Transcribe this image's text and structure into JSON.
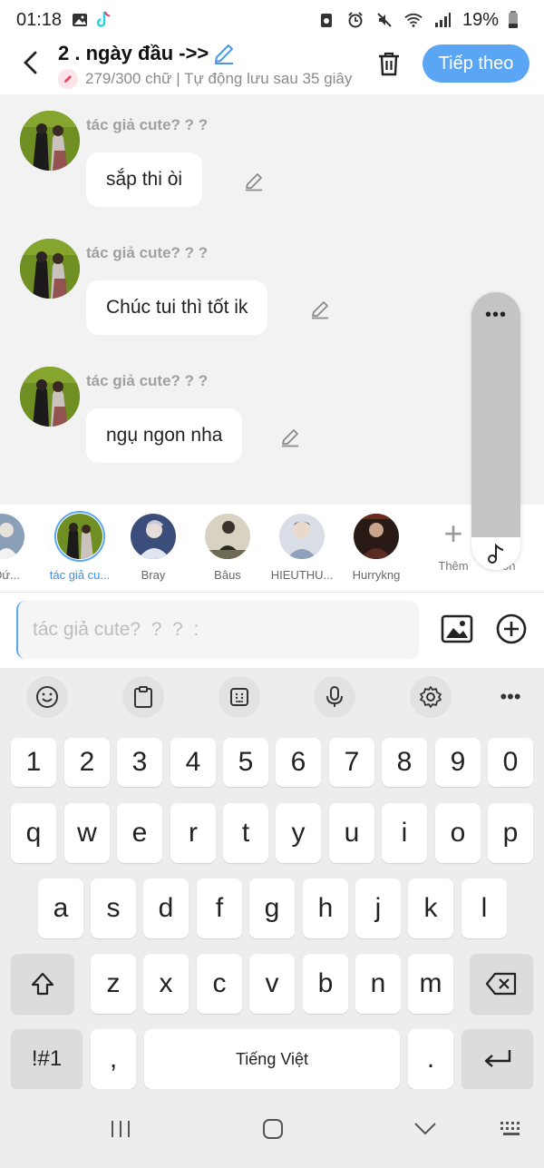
{
  "status_bar": {
    "time": "01:18",
    "battery": "19%"
  },
  "header": {
    "title": "2 . ngày đầu ->>",
    "subtitle": "279/300 chữ | Tự động lưu sau 35 giây",
    "next_label": "Tiếp theo"
  },
  "messages": [
    {
      "author": "tác giả cute?  ?  ?",
      "text": "sắp thi òi"
    },
    {
      "author": "tác giả cute?  ?  ?",
      "text": "Chúc tui thì tốt ik"
    },
    {
      "author": "tác giả cute?  ?  ?",
      "text": "ngụ ngon nha"
    }
  ],
  "side_panel": {
    "more": "•••"
  },
  "characters": [
    {
      "name": "g Đứ...",
      "color": "#8aa0b8"
    },
    {
      "name": "tác giả cu...",
      "color": "#6f8f23",
      "selected": true
    },
    {
      "name": "Bray",
      "color": "#3b4d7a"
    },
    {
      "name": "Bâus",
      "color": "#6e6a54"
    },
    {
      "name": "HIEUTHU...",
      "color": "#8ea1bd"
    },
    {
      "name": "Hurrykng",
      "color": "#5a2c22"
    }
  ],
  "add_character": {
    "label": "Thêm",
    "hidden_label": "ón"
  },
  "input": {
    "placeholder": "tác giả cute?  ?  ?  :"
  },
  "keyboard": {
    "numbers": [
      "1",
      "2",
      "3",
      "4",
      "5",
      "6",
      "7",
      "8",
      "9",
      "0"
    ],
    "row1": [
      "q",
      "w",
      "e",
      "r",
      "t",
      "y",
      "u",
      "i",
      "o",
      "p"
    ],
    "row2": [
      "a",
      "s",
      "d",
      "f",
      "g",
      "h",
      "j",
      "k",
      "l"
    ],
    "row3": [
      "z",
      "x",
      "c",
      "v",
      "b",
      "n",
      "m"
    ],
    "symbols": "!#1",
    "comma": ",",
    "space": "Tiếng Việt",
    "period": "."
  }
}
